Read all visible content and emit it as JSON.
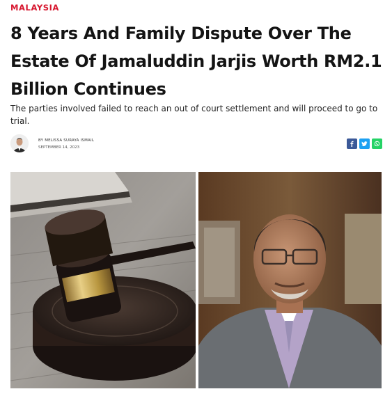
{
  "article": {
    "category": "MALAYSIA",
    "title": "8 Years And Family Dispute Over The Estate Of Jamaluddin Jarjis Worth RM2.1 Billion Continues",
    "subtitle": "The parties involved failed to reach an out of court settlement and will proceed to go to trial.",
    "byline": {
      "prefix": "BY",
      "author": "MELISSA SURAYA ISMAIL",
      "date": "SEPTEMBER 14, 2023"
    },
    "share": [
      {
        "network": "facebook",
        "icon": "facebook-icon",
        "color": "#3b5998"
      },
      {
        "network": "twitter",
        "icon": "twitter-icon",
        "color": "#1da1f2"
      },
      {
        "network": "whatsapp",
        "icon": "whatsapp-icon",
        "color": "#25d366"
      }
    ],
    "colors": {
      "category": "#d7162e",
      "headline": "#141414"
    }
  }
}
